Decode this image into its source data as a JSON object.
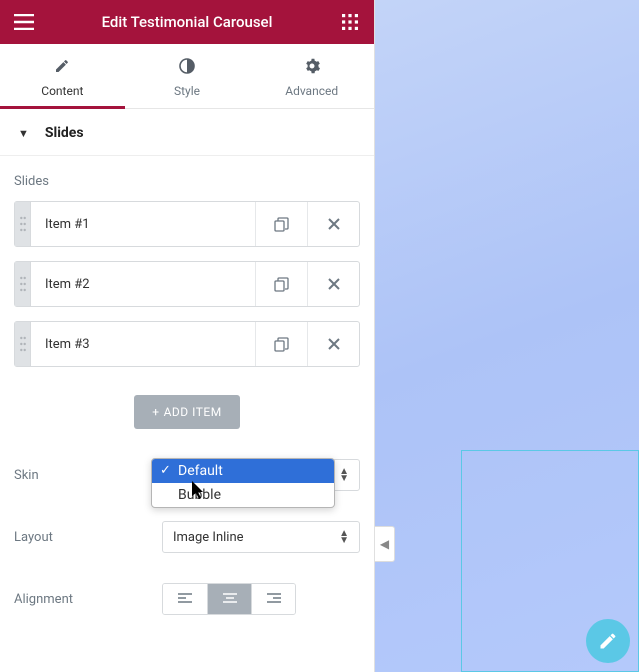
{
  "topbar": {
    "title": "Edit Testimonial Carousel"
  },
  "tabs": {
    "content": "Content",
    "style": "Style",
    "advanced": "Advanced"
  },
  "section": {
    "title": "Slides"
  },
  "slides": {
    "label": "Slides",
    "items": [
      {
        "label": "Item #1"
      },
      {
        "label": "Item #2"
      },
      {
        "label": "Item #3"
      }
    ],
    "add": "ADD ITEM"
  },
  "skin": {
    "label": "Skin",
    "options": [
      "Default",
      "Bubble"
    ],
    "selected": "Default"
  },
  "layout": {
    "label": "Layout",
    "value": "Image Inline"
  },
  "alignment": {
    "label": "Alignment"
  },
  "colors": {
    "brand": "#a4133c"
  }
}
